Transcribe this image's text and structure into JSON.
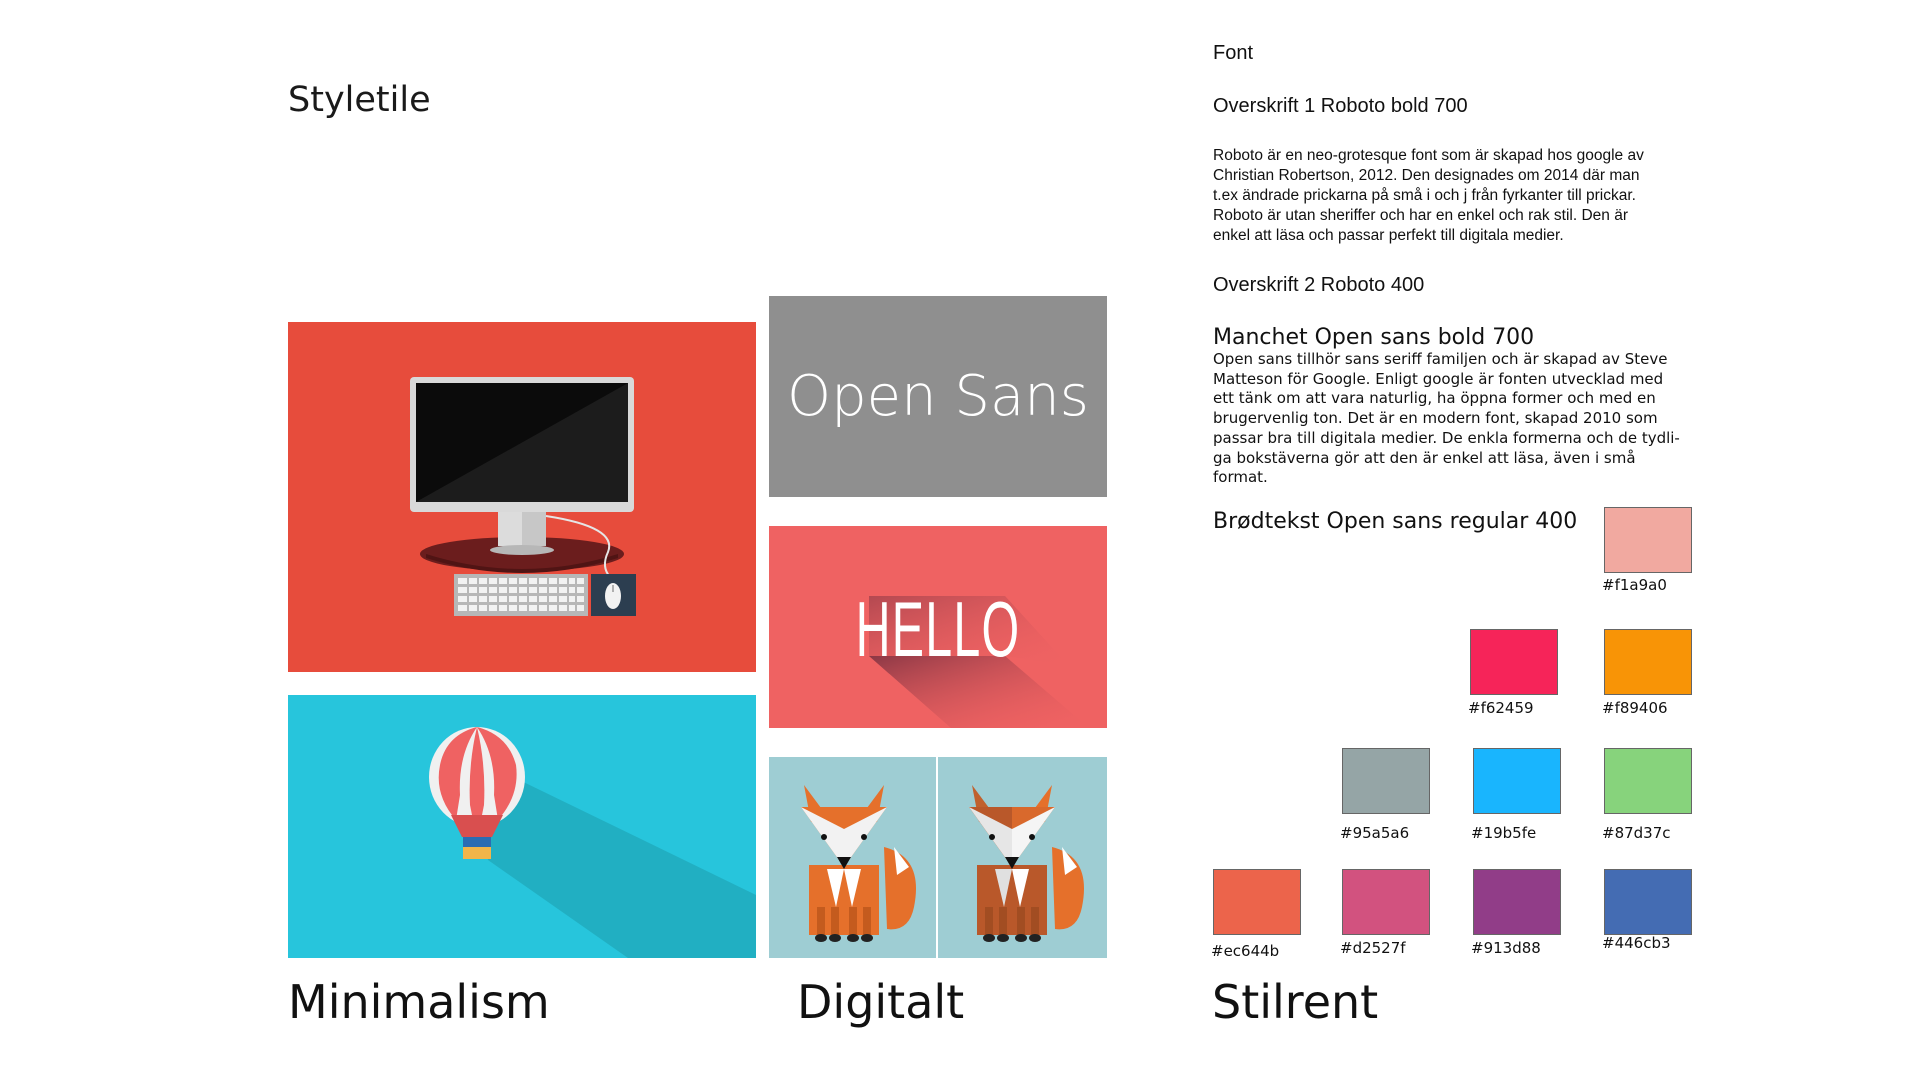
{
  "title": "Styletile",
  "tiles": {
    "opensans_text": "Open Sans",
    "hello_text": "HELLO"
  },
  "captions": [
    "Minimalism",
    "Digitalt",
    "Stilrent"
  ],
  "font_section": {
    "heading": "Font",
    "h1": "Overskrift 1 Roboto bold 700",
    "roboto_text": "Roboto är en neo-grotesque font som är skapad hos google av\nChristian Robertson, 2012. Den designades om 2014 där man\nt.ex ändrade prickarna på små i och j från fyrkanter till prickar.\nRoboto är utan sheriffer och har en enkel och rak stil. Den är\nenkel att läsa och passar perfekt till digitala medier.",
    "h2": "Overskrift 2 Roboto 400",
    "manchet": "Manchet Open sans bold 700",
    "opensans_text": "Open sans tillhör sans seriff familjen och är skapad av Steve\nMatteson för Google. Enligt google är fonten utvecklad med\nett tänk om att vara naturlig, ha öppna former och med en\nbrugervenlig ton. Det är en modern font, skapad 2010 som\npassar bra till digitala medier. De enkla formerna och de tydli-\nga bokstäverna gör att den är enkel att läsa, även i små\nformat.",
    "brodtekst": "Brødtekst Open sans regular 400"
  },
  "swatches": [
    {
      "label": "#f1a9a0",
      "color": "#f1a9a0"
    },
    {
      "label": "#f62459",
      "color": "#f62459"
    },
    {
      "label": "#f89406",
      "color": "#f89406"
    },
    {
      "label": "#95a5a6",
      "color": "#95a5a6"
    },
    {
      "label": "#19b5fe",
      "color": "#19b5fe"
    },
    {
      "label": "#87d37c",
      "color": "#87d37c"
    },
    {
      "label": "#ec644b",
      "color": "#ec644b"
    },
    {
      "label": "#d2527f",
      "color": "#d2527f"
    },
    {
      "label": "#913d88",
      "color": "#913d88"
    },
    {
      "label": "#446cb3",
      "color": "#446cb3"
    }
  ]
}
